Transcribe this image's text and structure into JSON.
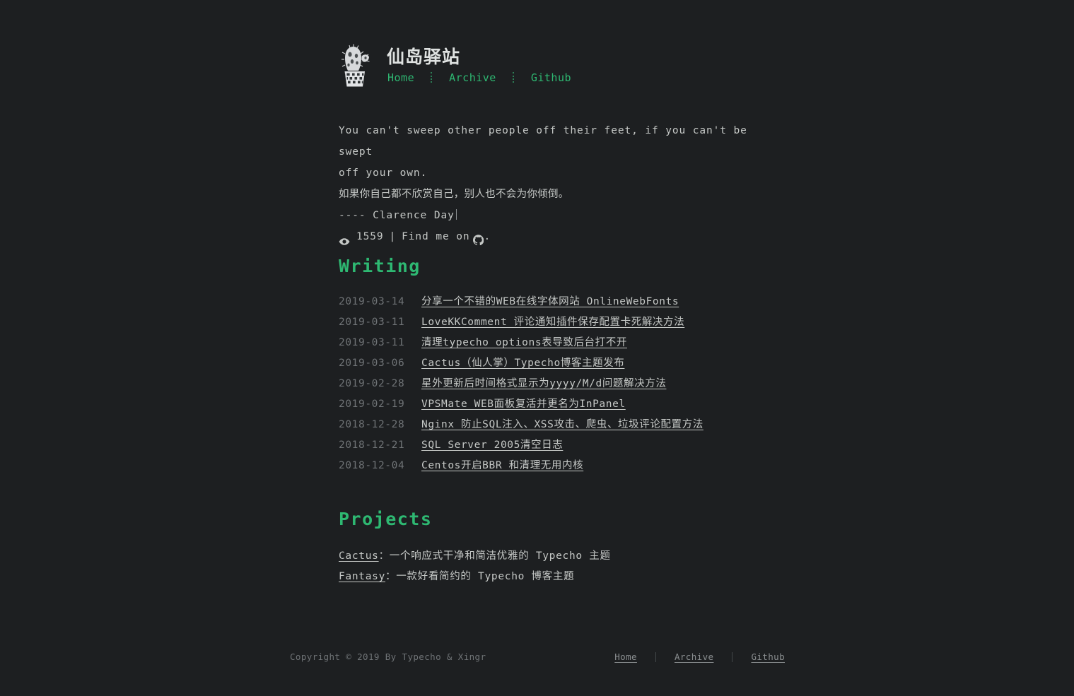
{
  "theme": {
    "background": "#1d1f21",
    "accent_green": "#2eb872",
    "text": "#c5c8c6",
    "muted": "#6f7376"
  },
  "header": {
    "logo_icon": "cactus-icon",
    "site_title": "仙岛驿站",
    "nav": [
      {
        "label": "Home"
      },
      {
        "label": "Archive"
      },
      {
        "label": "Github"
      }
    ]
  },
  "quote": {
    "line1": "You can't sweep other people off their feet, if you can't be swept",
    "line2": "off your own.",
    "translation": "如果你自己都不欣赏自己，别人也不会为你倾倒。",
    "author": "---- Clarence Day",
    "views_icon": "eye-icon",
    "views_count": "1559",
    "separator": "|",
    "find_me_text": "Find me on",
    "github_icon": "github-icon",
    "find_me_suffix": "."
  },
  "writing": {
    "heading": "Writing",
    "posts": [
      {
        "date": "2019-03-14",
        "title": "分享一个不错的WEB在线字体网站 OnlineWebFonts"
      },
      {
        "date": "2019-03-11",
        "title": "LoveKKComment 评论通知插件保存配置卡死解决方法"
      },
      {
        "date": "2019-03-11",
        "title": "清理typecho_options表导致后台打不开"
      },
      {
        "date": "2019-03-06",
        "title": "Cactus（仙人掌）Typecho博客主题发布"
      },
      {
        "date": "2019-02-28",
        "title": "星外更新后时间格式显示为yyyy/M/d问题解决方法"
      },
      {
        "date": "2019-02-19",
        "title": "VPSMate WEB面板复活并更名为InPanel"
      },
      {
        "date": "2018-12-28",
        "title": "Nginx 防止SQL注入、XSS攻击、爬虫、垃圾评论配置方法"
      },
      {
        "date": "2018-12-21",
        "title": "SQL Server 2005清空日志"
      },
      {
        "date": "2018-12-04",
        "title": "Centos开启BBR 和清理无用内核"
      }
    ]
  },
  "projects": {
    "heading": "Projects",
    "items": [
      {
        "name": "Cactus",
        "description": "：一个响应式干净和简洁优雅的 Typecho 主题"
      },
      {
        "name": "Fantasy",
        "description": "：一款好看简约的 Typecho 博客主题"
      }
    ]
  },
  "footer": {
    "copyright": "Copyright © 2019 By Typecho & Xingr",
    "nav": [
      {
        "label": "Home"
      },
      {
        "label": "Archive"
      },
      {
        "label": "Github"
      }
    ]
  }
}
